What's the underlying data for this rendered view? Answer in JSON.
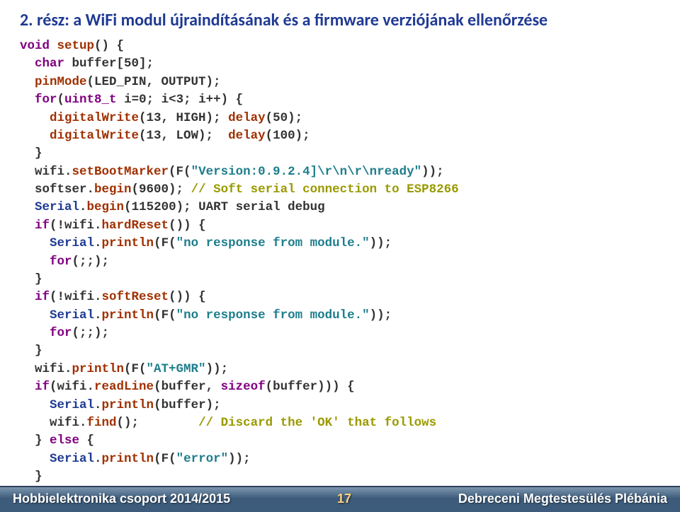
{
  "title": "2. rész: a WiFi modul újraindításának és a firmware verziójának ellenőrzése",
  "code": {
    "l1_kw": "void",
    "l1_fn": "setup",
    "l1_tail": "() {",
    "l2_kw": "char",
    "l2_id": " buffer[50];",
    "l3_fn": "pinMode",
    "l3_args": "(LED_PIN, OUTPUT);",
    "l4_kw": "for",
    "l4_a": "(",
    "l4_b": "uint8_t",
    "l4_c": " i=0; i<3; i++) {",
    "l5_fn": "digitalWrite",
    "l5_args": "(13, HIGH); ",
    "l5_fn2": "delay",
    "l5_args2": "(50);",
    "l6_fn": "digitalWrite",
    "l6_args": "(13, LOW);  ",
    "l6_fn2": "delay",
    "l6_args2": "(100);",
    "l7": "  }",
    "l8_a": "  wifi.",
    "l8_fn": "setBootMarker",
    "l8_b": "(F(",
    "l8_str": "\"Version:0.9.2.4]\\r\\n\\r\\nready\"",
    "l8_c": "));",
    "l9_a": "  softser.",
    "l9_fn": "begin",
    "l9_b": "(9600); ",
    "l9_cmt": "// Soft serial connection to ESP8266",
    "l10_a": "  ",
    "l10_cls": "Serial",
    "l10_b": ".",
    "l10_fn": "begin",
    "l10_c": "(115200); UART serial debug",
    "l11_kw": "if",
    "l11_a": "(!wifi.",
    "l11_fn": "hardReset",
    "l11_b": "()) {",
    "l12_cls": "Serial",
    "l12_a": ".",
    "l12_fn": "println",
    "l12_b": "(F(",
    "l12_str": "\"no response from module.\"",
    "l12_c": "));",
    "l13_kw": "for",
    "l13_a": "(;;);",
    "l14": "  }",
    "l15_kw": "if",
    "l15_a": "(!wifi.",
    "l15_fn": "softReset",
    "l15_b": "()) {",
    "l16_cls": "Serial",
    "l16_a": ".",
    "l16_fn": "println",
    "l16_b": "(F(",
    "l16_str": "\"no response from module.\"",
    "l16_c": "));",
    "l17_kw": "for",
    "l17_a": "(;;);",
    "l18": "  }",
    "l19_a": "  wifi.",
    "l19_fn": "println",
    "l19_b": "(F(",
    "l19_str": "\"AT+GMR\"",
    "l19_c": "));",
    "l20_kw": "if",
    "l20_a": "(wifi.",
    "l20_fn": "readLine",
    "l20_b": "(buffer, ",
    "l20_kw2": "sizeof",
    "l20_c": "(buffer))) {",
    "l21_cls": "Serial",
    "l21_a": ".",
    "l21_fn": "println",
    "l21_b": "(buffer);",
    "l22_a": "    wifi.",
    "l22_fn": "find",
    "l22_b": "();        ",
    "l22_cmt": "// Discard the 'OK' that follows",
    "l23_a": "  } ",
    "l23_kw": "else",
    "l23_b": " {",
    "l24_cls": "Serial",
    "l24_a": ".",
    "l24_fn": "println",
    "l24_b": "(F(",
    "l24_str": "\"error\"",
    "l24_c": "));",
    "l25": "  }"
  },
  "footer": {
    "left": "Hobbielektronika csoport 2014/2015",
    "page": "17",
    "right": "Debreceni Megtestesülés Plébánia"
  }
}
